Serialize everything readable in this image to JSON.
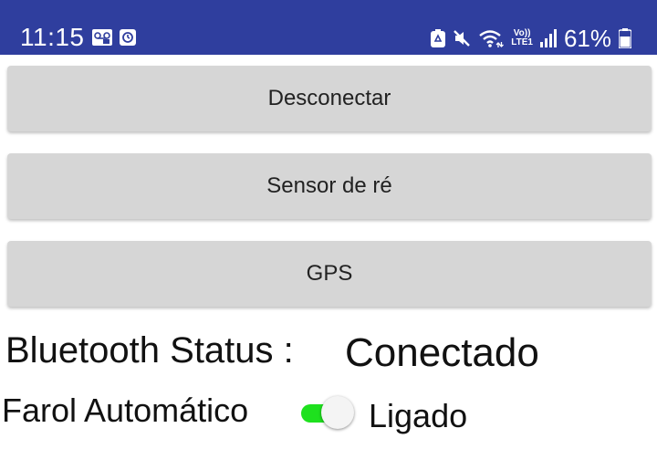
{
  "status_bar": {
    "time": "11:15",
    "left_icons": [
      "voicemail-icon",
      "clock-app-icon"
    ],
    "right_icons": [
      "recycle-icon",
      "mute-icon",
      "wifi-icon",
      "volte-icon",
      "signal-icon",
      "battery-icon"
    ],
    "volte_top": "Vo))",
    "volte_bottom": "LTE1",
    "battery": "61%",
    "background_color": "#2f3e9e"
  },
  "buttons": {
    "disconnect": "Desconectar",
    "sensor": "Sensor de ré",
    "gps": "GPS"
  },
  "bluetooth": {
    "label": "Bluetooth Status :",
    "value": "Conectado"
  },
  "farol": {
    "label": "Farol Automático",
    "state": "Ligado",
    "switch_on": true,
    "switch_color": "#1ee11e"
  }
}
